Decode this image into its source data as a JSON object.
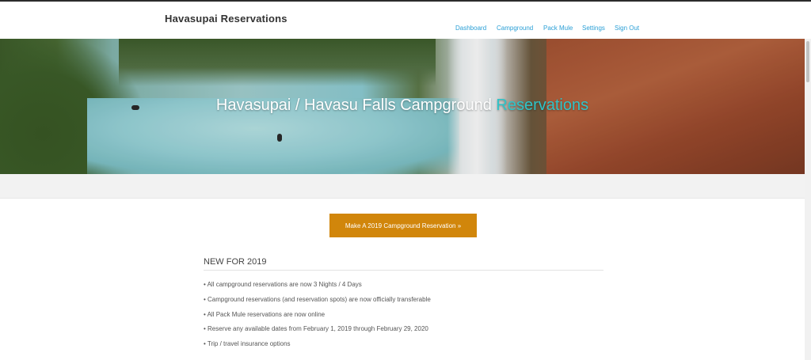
{
  "header": {
    "brand": "Havasupai Reservations",
    "nav": [
      "Dashboard",
      "Campground",
      "Pack Mule",
      "Settings",
      "Sign Out"
    ],
    "nav_color": "#2a9fd6"
  },
  "hero": {
    "title_main": "Havasupai / Havasu Falls Campground ",
    "title_accent": "Reservations",
    "accent_color": "#2ec4c9"
  },
  "cta": {
    "label": "Make A 2019 Campground Reservation »",
    "color": "#d1860b"
  },
  "new_section": {
    "title": "NEW FOR 2019",
    "items": [
      "• All campground reservations are now 3 Nights / 4 Days",
      "• Campground reservations (and reservation spots) are now officially transferable",
      "• All Pack Mule reservations are now online",
      "• Reserve any available dates from February 1, 2019 through February 29, 2020",
      "• Trip / travel insurance options"
    ]
  }
}
